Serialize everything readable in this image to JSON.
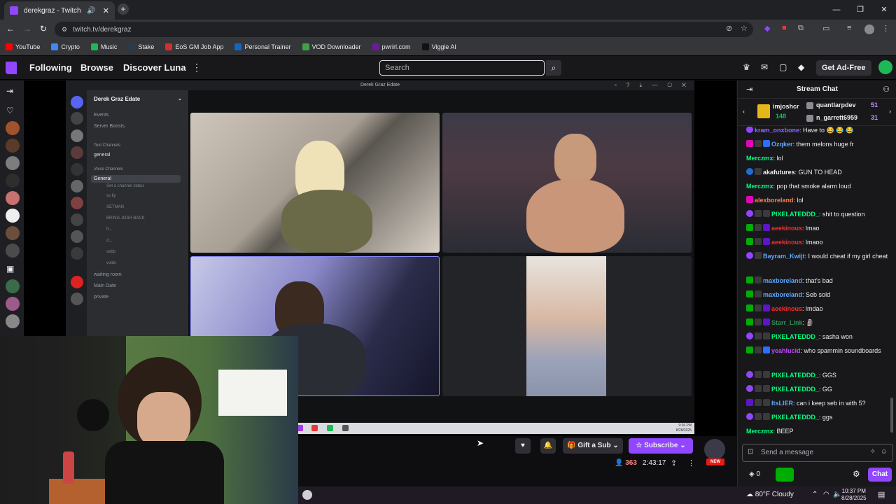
{
  "browser": {
    "tab_title": "derekgraz - Twitch",
    "url": "twitch.tv/derekgraz",
    "bookmarks": [
      {
        "label": "YouTube",
        "color": "#ff0000"
      },
      {
        "label": "Crypto",
        "color": "#4285f4"
      },
      {
        "label": "Music",
        "color": "#1db954"
      },
      {
        "label": "Stake",
        "color": "#2b3b4b"
      },
      {
        "label": "EoS GM Job App",
        "color": "#d32f2f"
      },
      {
        "label": "Personal Trainer",
        "color": "#1565c0"
      },
      {
        "label": "VOD Downloader",
        "color": "#43a047"
      },
      {
        "label": "pwrirl.com",
        "color": "#6a1b9a"
      },
      {
        "label": "Viggle AI",
        "color": "#111111"
      }
    ]
  },
  "twitch_nav": {
    "following": "Following",
    "browse": "Browse",
    "discover": "Discover Luna",
    "search_placeholder": "Search",
    "ad_free": "Get Ad-Free"
  },
  "discord": {
    "window_title": "Derek Graz Edate",
    "server_name": "Derek Graz Edate",
    "channels": {
      "events": "Events",
      "boosts": "Server Boosts",
      "text_header": "Text Channels",
      "general_text": "general",
      "voice_header": "Voice Channels",
      "general_voice": "General",
      "status": "Set a channel status",
      "members": [
        "ss lly",
        "SETMAN",
        "BRING JOSH BACK",
        "ft...",
        "d...",
        "sebb",
        "voids"
      ],
      "waiting": "waiting room",
      "main_date": "Main Date",
      "private": "private"
    },
    "tray_time": "9:36 PM",
    "tray_date": "8/28/2025"
  },
  "player": {
    "gift_label": "Gift a Sub",
    "subscribe_label": "Subscribe",
    "new_badge": "NEW",
    "viewers": "363",
    "uptime": "2:43:17"
  },
  "chat": {
    "title": "Stream Chat",
    "leaderboard": [
      {
        "name": "imjoshcr",
        "count": "148"
      },
      {
        "name": "quantlarpdev",
        "count": "51"
      },
      {
        "name": "n_garrett6959",
        "count": "31"
      }
    ],
    "messages": [
      {
        "name": "kram_onxbone",
        "color": "#8a6bff",
        "badges": [
          "b-sub"
        ],
        "text": "Have to 😂 😂 😂"
      },
      {
        "name": "Ozqker",
        "color": "#5fa8ff",
        "badges": [
          "b-vip",
          "b-mod",
          "b-gift"
        ],
        "text": "them melons huge fr"
      },
      {
        "name": "Merczmx",
        "color": "#00ff7f",
        "badges": [],
        "text": "lol"
      },
      {
        "name": "akafutures",
        "color": "#efeff1",
        "badges": [
          "b-one",
          "b-mod"
        ],
        "text": "GUN TO HEAD"
      },
      {
        "name": "Merczmx",
        "color": "#00ff7f",
        "badges": [],
        "text": "pop that smoke alarm loud"
      },
      {
        "name": "alexboreland",
        "color": "#ff7f50",
        "badges": [
          "b-vip"
        ],
        "text": "lol"
      },
      {
        "name": "PIXELATEDDD_",
        "color": "#00ff7f",
        "badges": [
          "b-sub",
          "b-mod",
          "b-mod"
        ],
        "text": "shit to question"
      },
      {
        "name": "aeekinous",
        "color": "#ff2b2b",
        "badges": [
          "b-chk",
          "b-mod",
          "b-prime"
        ],
        "text": "lmao"
      },
      {
        "name": "aeekinous",
        "color": "#ff2b2b",
        "badges": [
          "b-chk",
          "b-mod",
          "b-prime"
        ],
        "text": "lmaoo"
      },
      {
        "name": "Bayram_Kwijt",
        "color": "#5fa8ff",
        "badges": [
          "b-sub",
          "b-mod"
        ],
        "text": "I would cheat if my girl cheat"
      },
      {
        "name": "maxboreland",
        "color": "#5fa8ff",
        "badges": [
          "b-chk",
          "b-mod"
        ],
        "text": "that's bad"
      },
      {
        "name": "maxboreland",
        "color": "#5fa8ff",
        "badges": [
          "b-chk",
          "b-mod"
        ],
        "text": "Seb sold"
      },
      {
        "name": "aeekinous",
        "color": "#ff2b2b",
        "badges": [
          "b-chk",
          "b-mod",
          "b-prime"
        ],
        "text": "lmdao"
      },
      {
        "name": "Starr_Link",
        "color": "#2e8b57",
        "badges": [
          "b-chk",
          "b-mod",
          "b-prime"
        ],
        "text": "🗿"
      },
      {
        "name": "PIXELATEDDD_",
        "color": "#00ff7f",
        "badges": [
          "b-sub",
          "b-mod",
          "b-mod"
        ],
        "text": "sasha won"
      },
      {
        "name": "yeahlucid",
        "color": "#c04bff",
        "badges": [
          "b-chk",
          "b-mod",
          "b-gift"
        ],
        "text": "who spammin soundboards"
      },
      {
        "name": "PIXELATEDDD_",
        "color": "#00ff7f",
        "badges": [
          "b-sub",
          "b-mod",
          "b-mod"
        ],
        "text": "GGS"
      },
      {
        "name": "PIXELATEDDD_",
        "color": "#00ff7f",
        "badges": [
          "b-sub",
          "b-mod",
          "b-mod"
        ],
        "text": "GG"
      },
      {
        "name": "ItsLIER",
        "color": "#5fa8ff",
        "badges": [
          "b-prime",
          "b-mod",
          "b-mod"
        ],
        "text": "can i keep seb in with 5?"
      },
      {
        "name": "PIXELATEDDD_",
        "color": "#00ff7f",
        "badges": [
          "b-sub",
          "b-mod",
          "b-mod"
        ],
        "text": "ggs"
      },
      {
        "name": "Merczmx",
        "color": "#00ff7f",
        "badges": [],
        "text": "BEEP"
      }
    ],
    "input_placeholder": "Send a message",
    "points": "0",
    "chat_button": "Chat"
  },
  "taskbar": {
    "weather": "80°F  Cloudy",
    "time": "10:37 PM",
    "date": "8/28/2025"
  }
}
